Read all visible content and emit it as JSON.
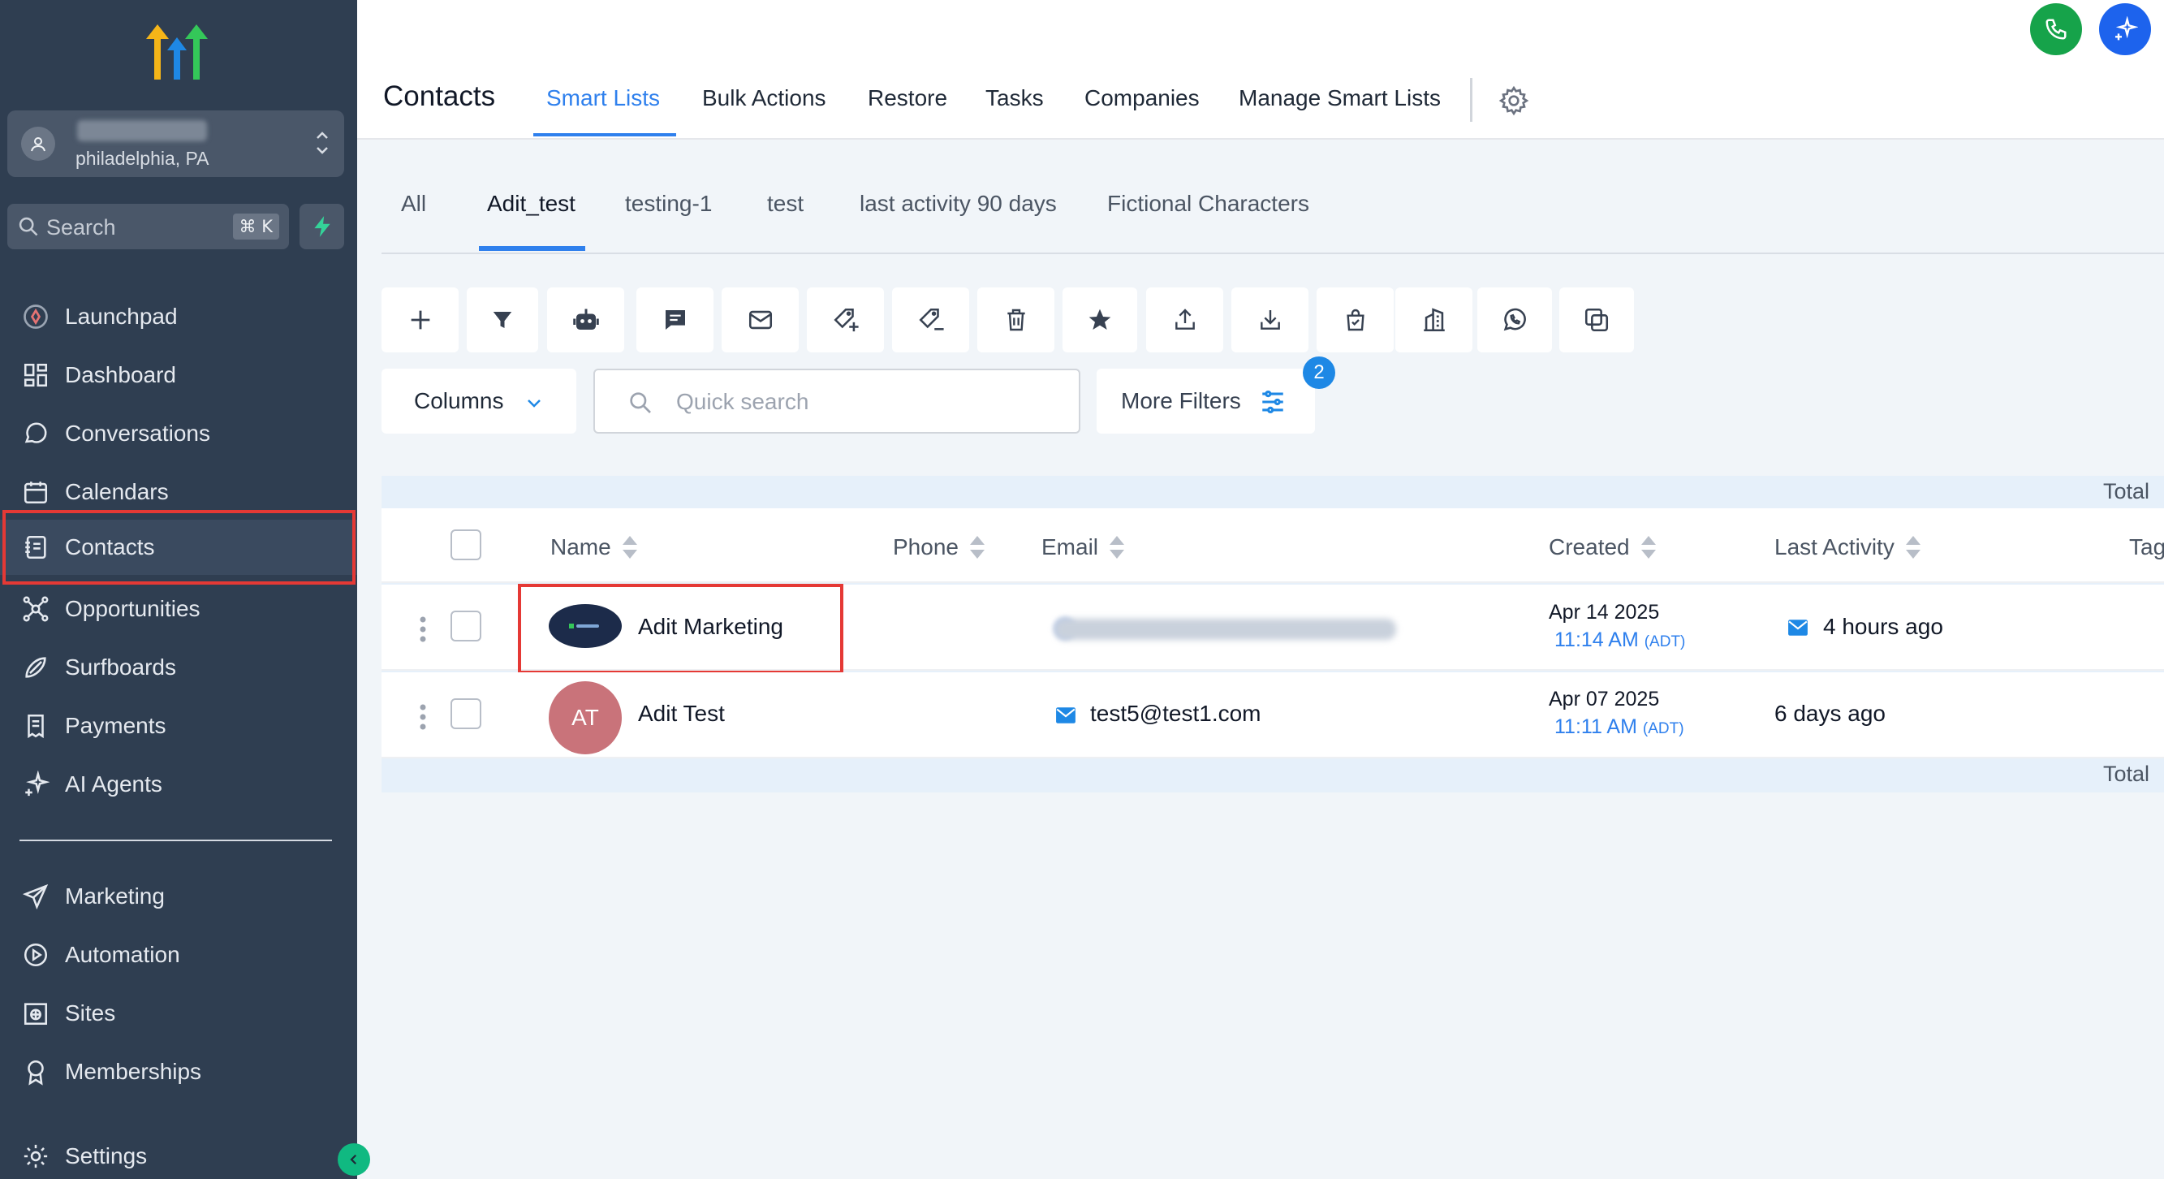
{
  "sidebar": {
    "account_location": "philadelphia, PA",
    "search_placeholder": "Search",
    "search_shortcut": "⌘ K",
    "nav_primary": [
      {
        "label": "Launchpad",
        "icon": "launchpad-icon"
      },
      {
        "label": "Dashboard",
        "icon": "dashboard-icon"
      },
      {
        "label": "Conversations",
        "icon": "chat-bubble-icon"
      },
      {
        "label": "Calendars",
        "icon": "calendar-icon"
      },
      {
        "label": "Contacts",
        "icon": "contacts-book-icon"
      },
      {
        "label": "Opportunities",
        "icon": "opportunities-icon"
      },
      {
        "label": "Surfboards",
        "icon": "surfboard-icon"
      },
      {
        "label": "Payments",
        "icon": "receipt-icon"
      },
      {
        "label": "AI Agents",
        "icon": "sparkle-icon"
      }
    ],
    "nav_secondary": [
      {
        "label": "Marketing",
        "icon": "send-icon"
      },
      {
        "label": "Automation",
        "icon": "automation-icon"
      },
      {
        "label": "Sites",
        "icon": "globe-icon"
      },
      {
        "label": "Memberships",
        "icon": "award-icon"
      },
      {
        "label": "Settings",
        "icon": "gear-icon"
      }
    ],
    "active_item": "Contacts",
    "colors": {
      "bg": "#2f3e51",
      "accent": "#10b981",
      "highlight": "#e53935"
    }
  },
  "header": {
    "title": "Contacts",
    "tabs": [
      "Smart Lists",
      "Bulk Actions",
      "Restore",
      "Tasks",
      "Companies",
      "Manage Smart Lists"
    ],
    "active_tab": "Smart Lists",
    "accent": "#2f80ed"
  },
  "smart_lists": {
    "tabs": [
      "All",
      "Adit_test",
      "testing-1",
      "test",
      "last activity 90 days",
      "Fictional Characters"
    ],
    "active": "Adit_test"
  },
  "toolbar": {
    "buttons": [
      "add-icon",
      "filter-icon",
      "robot-icon",
      "sms-icon",
      "email-icon",
      "add-tag-icon",
      "remove-tag-icon",
      "delete-icon",
      "star-icon",
      "upload-icon",
      "download-icon",
      "bag-icon",
      "company-icon",
      "whatsapp-icon",
      "merge-icon"
    ]
  },
  "filters": {
    "columns_label": "Columns",
    "quick_search_placeholder": "Quick search",
    "more_filters_label": "More Filters",
    "filter_count": "2"
  },
  "table": {
    "total_label": "Total",
    "columns": [
      "Name",
      "Phone",
      "Email",
      "Created",
      "Last Activity",
      "Tag"
    ],
    "rows": [
      {
        "name": "Adit Marketing",
        "avatar": "logo",
        "phone": "",
        "email": "",
        "created_date": "Apr 14 2025",
        "created_time": "11:14 AM",
        "tz": "(ADT)",
        "last_activity": "4 hours ago"
      },
      {
        "name": "Adit Test",
        "avatar": "AT",
        "phone": "",
        "email": "test5@test1.com",
        "created_date": "Apr 07 2025",
        "created_time": "11:11 AM",
        "tz": "(ADT)",
        "last_activity": "6 days ago"
      }
    ]
  }
}
